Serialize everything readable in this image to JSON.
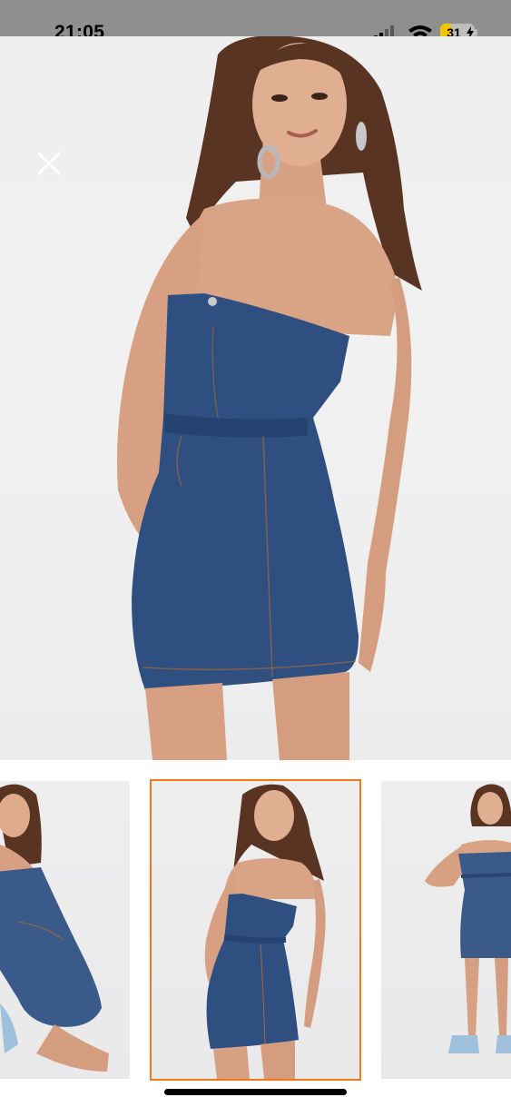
{
  "status_bar": {
    "time": "21:05",
    "battery": "31",
    "battery_level": 0.31,
    "icons": [
      "cellular-signal-icon",
      "wifi-icon",
      "battery-charging-icon"
    ]
  },
  "viewer": {
    "close_icon": "close-icon",
    "main_image": "strapless-denim-mini-dress-front",
    "selected_index": 1
  },
  "thumbnails": [
    {
      "name": "denim-dress-kneeling"
    },
    {
      "name": "denim-dress-front"
    },
    {
      "name": "denim-dress-full-length"
    }
  ],
  "colors": {
    "accent": "#f27a1a",
    "denim": "#2f4f80",
    "status_bar_bg": "#8f8f8f",
    "battery": "#f5c400"
  }
}
